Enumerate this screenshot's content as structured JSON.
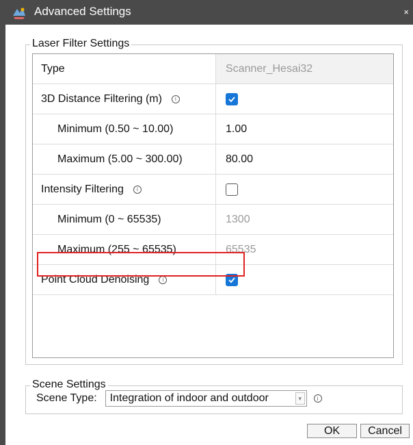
{
  "window": {
    "title": "Advanced Settings",
    "close_glyph": "×",
    "app_icon": "app-logo-icon"
  },
  "laser_group": {
    "legend": "Laser Filter Settings",
    "rows": [
      {
        "label": "Type",
        "value": "Scanner_Hesai32",
        "kind": "readonly"
      },
      {
        "label": "3D Distance Filtering (m)",
        "info": "ⓘ",
        "kind": "checkbox",
        "checked": true
      },
      {
        "label": "Minimum (0.50 ~ 10.00)",
        "value": "1.00",
        "kind": "text"
      },
      {
        "label": "Maximum (5.00 ~ 300.00)",
        "value": "80.00",
        "kind": "text"
      },
      {
        "label": "Intensity Filtering",
        "info": "ⓘ",
        "kind": "checkbox",
        "checked": false
      },
      {
        "label": "Minimum (0 ~ 65535)",
        "value": "1300",
        "kind": "disabled"
      },
      {
        "label": "Maximum (255 ~ 65535)",
        "value": "65535",
        "kind": "disabled"
      },
      {
        "label": "Point Cloud Denoising",
        "info": "ⓘ",
        "kind": "checkbox",
        "checked": true
      }
    ]
  },
  "scene_group": {
    "legend": "Scene Settings",
    "scene_type_label": "Scene Type:",
    "scene_type_value": "Integration of indoor and outdoor",
    "info": "ⓘ"
  },
  "buttons": {
    "ok": "OK",
    "cancel": "Cancel"
  },
  "colors": {
    "titlebar": "#4a4a4a",
    "checkbox_on": "#1677d8",
    "highlight": "#e02020"
  }
}
